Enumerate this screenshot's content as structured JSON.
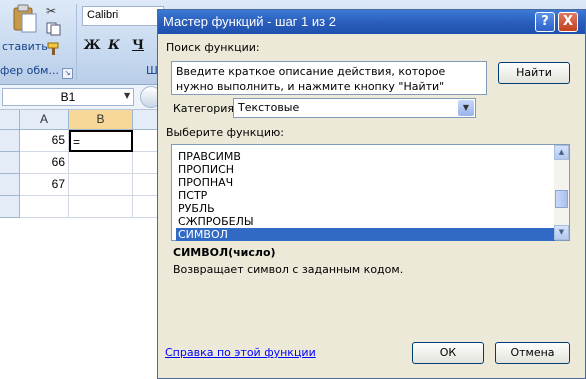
{
  "ribbon": {
    "paste_label": "ставить",
    "clipboard_group": "фер обм...",
    "font_name": "Calibri",
    "bold_label": "Ж",
    "italic_label": "К",
    "underline_label": "Ч",
    "font_group": "Ш"
  },
  "formula_bar": {
    "name_box": "B1"
  },
  "sheet": {
    "columns": [
      "A",
      "B"
    ],
    "rows": [
      {
        "a": "65",
        "b": "="
      },
      {
        "a": "66",
        "b": ""
      },
      {
        "a": "67",
        "b": ""
      }
    ]
  },
  "dialog": {
    "title": "Мастер функций - шаг 1 из 2",
    "help_button": "?",
    "close_button": "X",
    "search_label": "Поиск функции:",
    "search_text": "Введите краткое описание действия, которое нужно выполнить, и нажмите кнопку \"Найти\"",
    "find_button": "Найти",
    "category_label": "Категория:",
    "category_value": "Текстовые",
    "select_label": "Выберите функцию:",
    "functions": [
      "ПРАВСИМВ",
      "ПРОПИСН",
      "ПРОПНАЧ",
      "ПСТР",
      "РУБЛЬ",
      "СЖПРОБЕЛЫ",
      "СИМВОЛ"
    ],
    "selected_function": "СИМВОЛ",
    "signature": "СИМВОЛ(число)",
    "description": "Возвращает символ с заданным кодом.",
    "help_link": "Справка по этой функции",
    "ok_button": "ОК",
    "cancel_button": "Отмена"
  },
  "colors": {
    "titlebar": "#2a5ebd",
    "selection": "#316ac5",
    "link": "#0000ff"
  }
}
